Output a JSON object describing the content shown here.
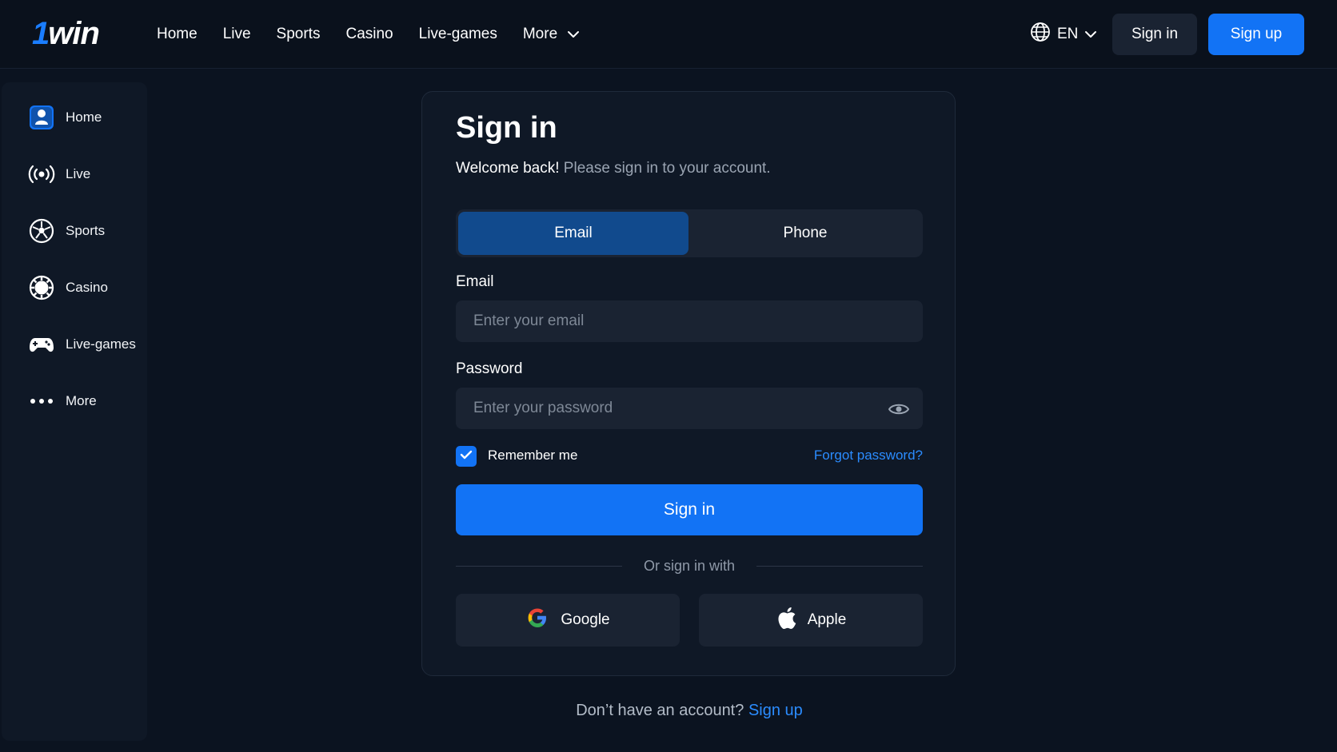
{
  "header": {
    "logo_prefix": "1",
    "logo_suffix": "win",
    "nav": [
      {
        "label": "Home"
      },
      {
        "label": "Live"
      },
      {
        "label": "Sports"
      },
      {
        "label": "Casino"
      },
      {
        "label": "Live-games"
      },
      {
        "label": "More"
      }
    ],
    "language": "EN",
    "signin_label": "Sign in",
    "signup_label": "Sign up"
  },
  "sidebar": {
    "items": [
      {
        "label": "Home",
        "icon": "home-icon"
      },
      {
        "label": "Live",
        "icon": "broadcast-icon"
      },
      {
        "label": "Sports",
        "icon": "soccer-ball-icon"
      },
      {
        "label": "Casino",
        "icon": "casino-chip-icon"
      },
      {
        "label": "Live-games",
        "icon": "gamepad-icon"
      },
      {
        "label": "More",
        "icon": "more-dots-icon"
      }
    ]
  },
  "signin": {
    "title": "Sign in",
    "subtitle_strong": "Welcome back!",
    "subtitle_rest": " Please sign in to your account.",
    "tabs": [
      {
        "label": "Email",
        "active": true
      },
      {
        "label": "Phone",
        "active": false
      }
    ],
    "email_label": "Email",
    "email_placeholder": "Enter your email",
    "email_value": "",
    "password_label": "Password",
    "password_placeholder": "Enter your password",
    "password_value": "",
    "remember_label": "Remember me",
    "remember_checked": true,
    "forgot_label": "Forgot password?",
    "submit_label": "Sign in",
    "divider_label": "Or sign in with",
    "google_label": "Google",
    "apple_label": "Apple"
  },
  "footer": {
    "prompt": "Don’t have an account?",
    "signup_link": "Sign up"
  },
  "colors": {
    "accent": "#1273f5",
    "link": "#2b8cff",
    "background": "#0b1320",
    "panel": "#0f1826",
    "input": "#1a2332"
  }
}
